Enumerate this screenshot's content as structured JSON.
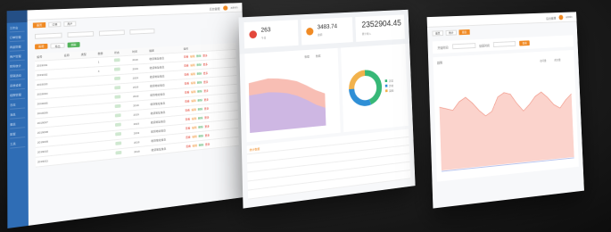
{
  "colors": {
    "accent": "#f08a24",
    "sidebar": "#2f6db5",
    "area": "#f7b7ac",
    "donut_green": "#37b877",
    "donut_blue": "#2f8fd6",
    "donut_orange": "#f2b24c"
  },
  "panel1": {
    "header_right": "后台管理",
    "user": "admin",
    "tabs": [
      "首页",
      "订单",
      "用户"
    ],
    "sidebar_items": [
      "工作台",
      "订单管理",
      "商品管理",
      "用户管理",
      "财务统计",
      "营销活动",
      "系统设置",
      "权限管理",
      "日志",
      "消息",
      "报表",
      "配置",
      "工具"
    ],
    "buttons": [
      "新增",
      "导出",
      "刷新"
    ],
    "columns": [
      "编号",
      "名称",
      "类型",
      "数量",
      "状态",
      "时间",
      "描述",
      "操作"
    ],
    "rows": [
      [
        "2019001",
        "",
        "",
        "1",
        "",
        "2019",
        "收货地址信息",
        ""
      ],
      [
        "2019002",
        "",
        "",
        "4",
        "",
        "2019",
        "收货地址信息",
        ""
      ],
      [
        "2019003",
        "",
        "",
        "",
        "",
        "2019",
        "收货地址信息",
        ""
      ],
      [
        "2019004",
        "",
        "",
        "",
        "",
        "2019",
        "收货地址信息",
        ""
      ],
      [
        "2019005",
        "",
        "",
        "",
        "",
        "2019",
        "收货地址信息",
        ""
      ],
      [
        "2019006",
        "",
        "",
        "",
        "",
        "2019",
        "收货地址信息",
        ""
      ],
      [
        "2019007",
        "",
        "",
        "",
        "",
        "2019",
        "收货地址信息",
        ""
      ],
      [
        "2019008",
        "",
        "",
        "",
        "",
        "2019",
        "收货地址信息",
        ""
      ],
      [
        "2019009",
        "",
        "",
        "",
        "",
        "2019",
        "收货地址信息",
        ""
      ],
      [
        "2019010",
        "",
        "",
        "",
        "",
        "2019",
        "收货地址信息",
        ""
      ],
      [
        "2019011",
        "",
        "",
        "",
        "",
        "2019",
        "收货地址信息",
        ""
      ]
    ],
    "ops": [
      "查看",
      "编辑",
      "删除",
      "更多"
    ]
  },
  "panel2": {
    "stats": [
      {
        "value": "263",
        "label": "今日"
      },
      {
        "value": "3483.74",
        "label": "金额"
      },
      {
        "value": "2352904.45",
        "label": "累计收入"
      }
    ],
    "legend": [
      "数据",
      "数据"
    ],
    "donut_legend": [
      "正常",
      "异常",
      "其他"
    ],
    "section_title": "统计数据",
    "table_rows": [
      [
        "",
        "",
        "",
        ""
      ],
      [
        "",
        "",
        "",
        ""
      ],
      [
        "",
        "",
        "",
        ""
      ],
      [
        "",
        "",
        "",
        ""
      ],
      [
        "",
        "",
        "",
        ""
      ]
    ]
  },
  "panel3": {
    "header_right": "后台管理",
    "user": "admin",
    "tabs": [
      "首页",
      "统计",
      "报表"
    ],
    "filter_labels": [
      "开始时间",
      "结束时间",
      "查询"
    ],
    "chart_title": "趋势",
    "legend": [
      "访问量",
      "成交量"
    ]
  },
  "chart_data": [
    {
      "type": "area",
      "series": [
        {
          "values": [
            60,
            62,
            64,
            63,
            61,
            58,
            52,
            45,
            40
          ]
        },
        {
          "values": [
            45,
            46,
            47,
            46,
            44,
            40,
            34,
            27,
            22
          ]
        }
      ]
    },
    {
      "type": "pie",
      "values": [
        45,
        30,
        25
      ]
    },
    {
      "type": "area",
      "values": [
        62,
        60,
        58,
        66,
        70,
        64,
        56,
        50,
        54,
        68,
        72,
        70,
        60,
        52,
        58,
        66,
        70,
        64,
        56,
        52,
        60,
        66
      ]
    }
  ]
}
